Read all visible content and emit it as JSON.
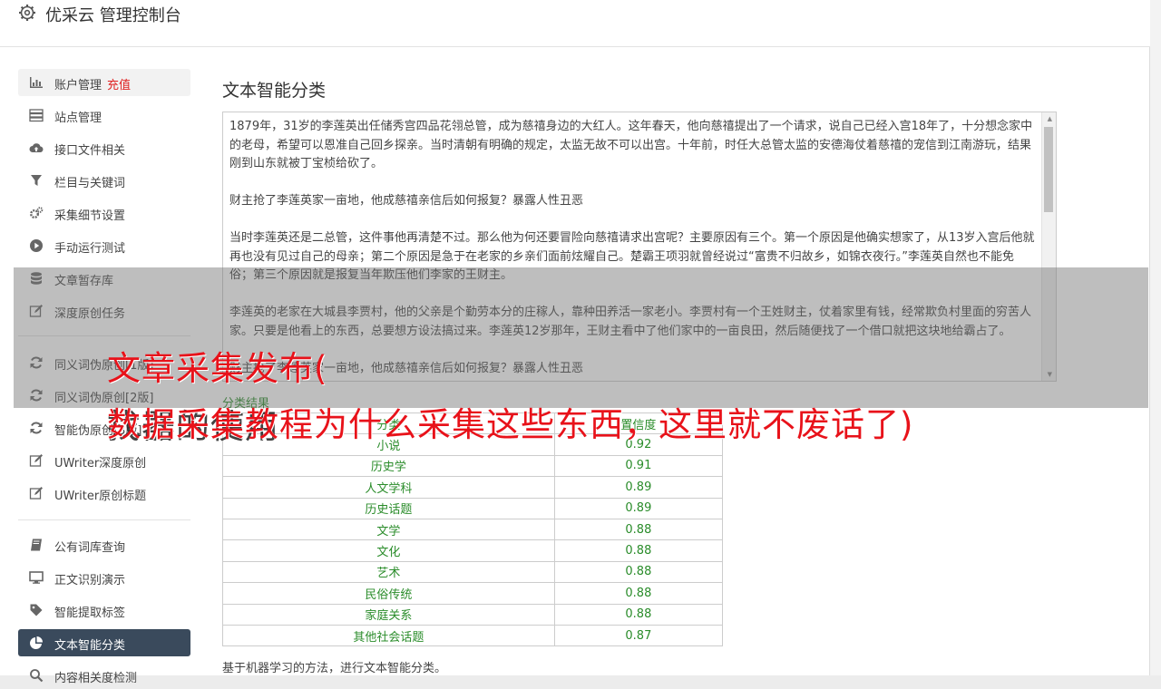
{
  "app": {
    "title": "优采云 管理控制台",
    "icon": "gear-icon"
  },
  "sidebar": {
    "items": [
      {
        "label": "账户管理",
        "badge": "充值",
        "icon": "bar-chart-icon"
      },
      {
        "label": "站点管理",
        "icon": "server-icon"
      },
      {
        "label": "接口文件相关",
        "icon": "cloud-upload-icon"
      },
      {
        "label": "栏目与关键词",
        "icon": "filter-icon"
      },
      {
        "label": "采集细节设置",
        "icon": "gears-icon"
      },
      {
        "label": "手动运行测试",
        "icon": "play-circle-icon"
      },
      {
        "label": "文章暂存库",
        "icon": "database-icon"
      },
      {
        "label": "深度原创任务",
        "icon": "edit-icon"
      },
      {
        "label": "同义词伪原创[1版]",
        "icon": "refresh-icon"
      },
      {
        "label": "同义词伪原创[2版]",
        "icon": "refresh-icon"
      },
      {
        "label": "智能伪原创[3版]",
        "icon": "refresh-icon"
      },
      {
        "label": "UWriter深度原创",
        "icon": "edit-icon"
      },
      {
        "label": "UWriter原创标题",
        "icon": "edit-icon"
      },
      {
        "label": "公有词库查询",
        "icon": "book-icon"
      },
      {
        "label": "正文识别演示",
        "icon": "monitor-icon"
      },
      {
        "label": "智能提取标签",
        "icon": "tag-icon"
      },
      {
        "label": "文本智能分类",
        "icon": "pie-chart-icon"
      },
      {
        "label": "内容相关度检测",
        "icon": "search-icon"
      }
    ]
  },
  "main": {
    "title": "文本智能分类",
    "paragraphs": [
      "1879年，31岁的李莲英出任储秀宫四品花翎总管，成为慈禧身边的大红人。这年春天，他向慈禧提出了一个请求，说自己已经入宫18年了，十分想念家中的老母，希望可以恩准自己回乡探亲。当时清朝有明确的规定，太监无故不可以出宫。十年前，时任大总管太监的安德海仗着慈禧的宠信到江南游玩，结果刚到山东就被丁宝桢给砍了。",
      "财主抢了李莲英家一亩地，他成慈禧亲信后如何报复？暴露人性丑恶",
      "当时李莲英还是二总管，这件事他再清楚不过。那么他为何还要冒险向慈禧请求出宫呢？主要原因有三个。第一个原因是他确实想家了，从13岁入宫后他就再也没有见过自己的母亲；第二个原因是急于在老家的乡亲们面前炫耀自己。楚霸王项羽就曾经说过“富贵不归故乡，如锦衣夜行。”李莲英自然也不能免俗；第三个原因就是报复当年欺压他们李家的王财主。",
      "李莲英的老家在大城县李贾村，他的父亲是个勤劳本分的庄稼人，靠种田养活一家老小。李贾村有一个王姓财主，仗着家里有钱，经常欺负村里面的穷苦人家。只要是他看上的东西，总要想方设法搞过来。李莲英12岁那年，王财主看中了他们家中的一亩良田，然后随便找了一个借口就把这块地给霸占了。",
      "财主抢了李莲英家一亩地，他成慈禧亲信后如何报复？暴露人性丑恶"
    ],
    "results_label": "分类结果",
    "table": {
      "headers": [
        "分类",
        "置信度"
      ],
      "rows": [
        [
          "小说",
          "0.92"
        ],
        [
          "历史学",
          "0.91"
        ],
        [
          "人文学科",
          "0.89"
        ],
        [
          "历史话题",
          "0.89"
        ],
        [
          "文学",
          "0.88"
        ],
        [
          "文化",
          "0.88"
        ],
        [
          "艺术",
          "0.88"
        ],
        [
          "民俗传统",
          "0.88"
        ],
        [
          "家庭关系",
          "0.88"
        ],
        [
          "其他社会话题",
          "0.87"
        ]
      ]
    },
    "note": "基于机器学习的方法，进行文本智能分类。"
  },
  "overlay": {
    "line1": "文章采集发布(",
    "line2": "数据采集教程为什么采集这些东西，这里就不废话了)",
    "line3": "找器的使用"
  },
  "colors": {
    "accent_red": "#e8121a",
    "result_green": "#2a8c2a",
    "active_bg": "#3a4a5c"
  }
}
